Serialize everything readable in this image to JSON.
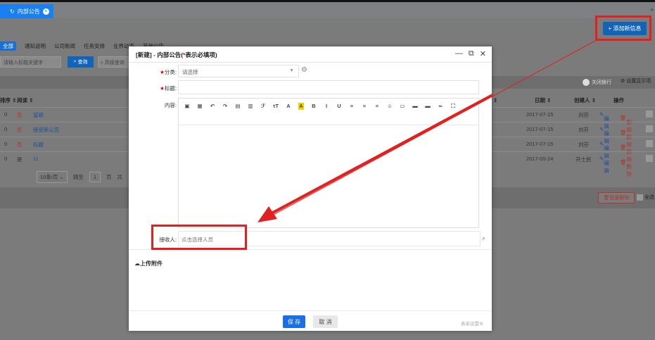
{
  "tabs": {
    "active_label": "内部公告",
    "close_icon": "close-icon",
    "more_icon": "»"
  },
  "toolbar": {
    "add_label": "+ 添加新信息"
  },
  "categories": [
    "全部",
    "通知说明",
    "公司新闻",
    "任务安排",
    "业界动态",
    "其他公告"
  ],
  "search": {
    "placeholder": "请输入标题关键字",
    "query_label": "查询",
    "advanced_label": "高级查询"
  },
  "table_opts": {
    "toggle_label": "关闭换行",
    "columns_label": "设置显示项"
  },
  "table": {
    "headers": {
      "order": "排序",
      "read": "阅读",
      "date": "日期",
      "creator": "创建人",
      "ops": "操作"
    },
    "rows": [
      {
        "order": "0",
        "read": "否",
        "title": "富顿",
        "date": "2017-07-15",
        "creator": "刘芬"
      },
      {
        "order": "0",
        "read": "否",
        "title": "接受新公告",
        "date": "2017-07-15",
        "creator": "刘芬"
      },
      {
        "order": "0",
        "read": "否",
        "title": "标题",
        "date": "2017-07-15",
        "creator": "刘芬"
      },
      {
        "order": "0",
        "read": "是",
        "title": "11",
        "date": "2017-05-24",
        "creator": "开士民"
      }
    ],
    "edit_label": "编辑",
    "delete_label": "删除"
  },
  "pager": {
    "per_page": "10条/页",
    "goto_label": "跳至",
    "page_value": "1",
    "page_unit": "页",
    "total_prefix": "共"
  },
  "bottom": {
    "batch_delete_label": "批量删除",
    "select_all_label": "全选"
  },
  "dialog": {
    "title_prefix": "[新建] - 内部公告(",
    "title_required": "*",
    "title_suffix": "表示必填项)",
    "category_label": "分类:",
    "category_placeholder": "请选择",
    "title_label": "标题:",
    "content_label": "内容:",
    "receiver_label": "接收人:",
    "receiver_placeholder": "点击选择人员",
    "upload_label": "上传附件",
    "save_label": "保 存",
    "cancel_label": "取 消",
    "form_settings_label": "表单设置"
  },
  "colors": {
    "primary": "#1a6fe8",
    "highlight_red": "#e41f1f",
    "required": "#dd0000"
  }
}
